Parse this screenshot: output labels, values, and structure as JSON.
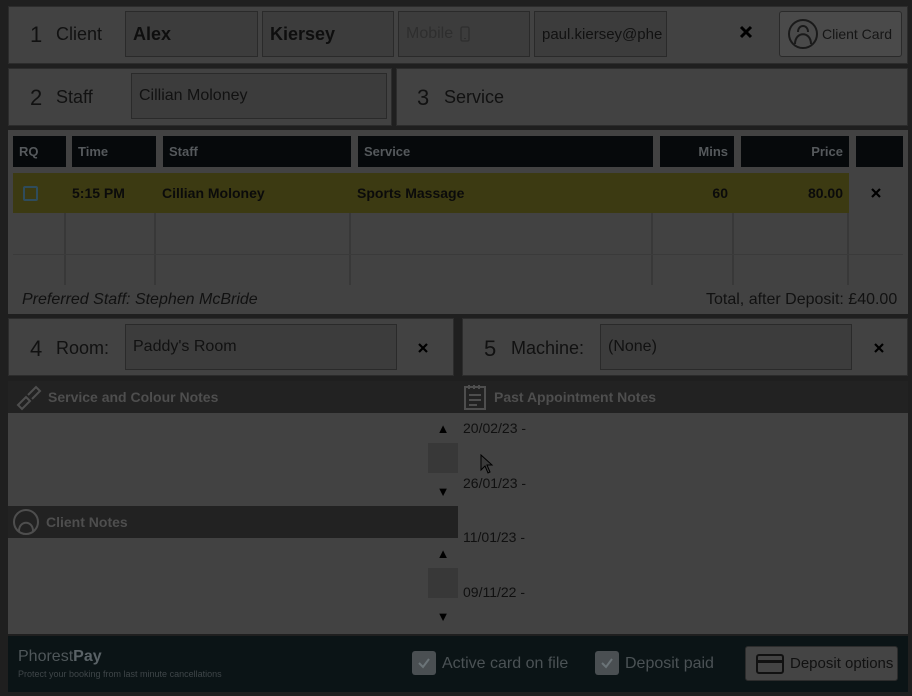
{
  "client": {
    "step": "1",
    "label": "Client",
    "first_name": "Alex",
    "last_name": "Kiersey",
    "mobile_placeholder": "Mobile",
    "email": "paul.kiersey@phe",
    "card_button": "Client Card"
  },
  "staff": {
    "step": "2",
    "label": "Staff",
    "value": "Cillian Moloney"
  },
  "service": {
    "step": "3",
    "label": "Service"
  },
  "table": {
    "headers": [
      "RQ",
      "Time",
      "Staff",
      "Service",
      "Mins",
      "Price"
    ],
    "rows": [
      {
        "time": "5:15 PM",
        "staff": "Cillian Moloney",
        "service": "Sports Massage",
        "mins": "60",
        "price": "80.00"
      }
    ]
  },
  "summary": {
    "preferred_staff": "Preferred Staff:  Stephen McBride",
    "total": "Total, after Deposit: £40.00"
  },
  "room": {
    "step": "4",
    "label": "Room:",
    "value": "Paddy's Room"
  },
  "machine": {
    "step": "5",
    "label": "Machine:",
    "value": "(None)"
  },
  "notes": {
    "service_colour_title": "Service and Colour Notes",
    "client_notes_title": "Client Notes",
    "past_title": "Past Appointment Notes",
    "past_dates": [
      "20/02/23 -",
      "26/01/23 -",
      "11/01/23 -",
      "09/11/22 -"
    ]
  },
  "footer": {
    "brand_a": "Phorest",
    "brand_b": "Pay",
    "tagline": "Protect your booking from last minute cancellations",
    "active_card": "Active card on file",
    "deposit_paid": "Deposit paid",
    "deposit_options": "Deposit options"
  },
  "icons": {
    "close": "close-icon",
    "phone": "phone-icon",
    "client_card": "client-card-icon",
    "checkbox": "checkbox-icon"
  }
}
